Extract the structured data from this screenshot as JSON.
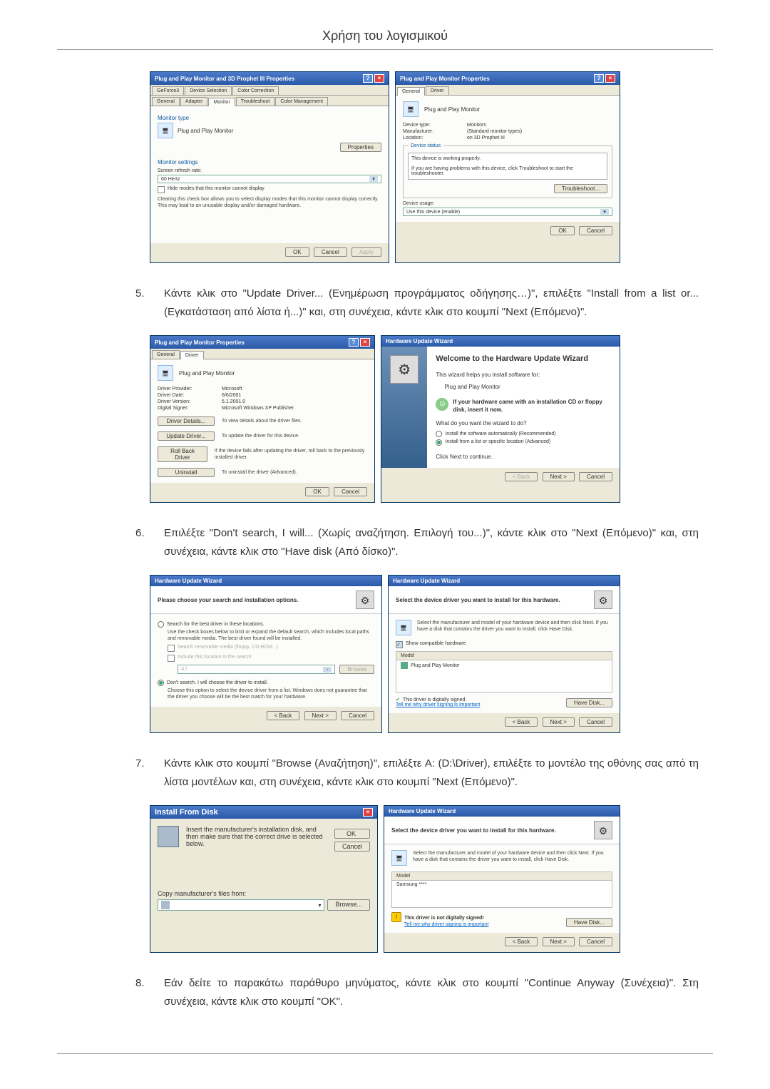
{
  "page_title": "Χρήση του λογισμικού",
  "steps": {
    "s5": {
      "num": "5.",
      "text": "Κάντε κλικ στο \"Update Driver... (Ενημέρωση προγράμματος οδήγησης…)\", επιλέξτε \"Install from a list or...(Εγκατάσταση από λίστα ή...)\" και, στη συνέχεια, κάντε κλικ στο κουμπί \"Next (Επόμενο)\"."
    },
    "s6": {
      "num": "6.",
      "text": "Επιλέξτε \"Don't search, I will... (Χωρίς αναζήτηση. Επιλογή του...)\", κάντε κλικ στο \"Next (Επόμενο)\" και, στη συνέχεια, κάντε κλικ στο \"Have disk (Από δίσκο)\"."
    },
    "s7": {
      "num": "7.",
      "text": "Κάντε κλικ στο κουμπί \"Browse (Αναζήτηση)\", επιλέξτε A: (D:\\Driver), επιλέξτε το μοντέλο της οθόνης σας από τη λίστα μοντέλων και, στη συνέχεια, κάντε κλικ στο κουμπί \"Next (Επόμενο)\"."
    },
    "s8": {
      "num": "8.",
      "text": "Εάν δείτε το παρακάτω παράθυρο μηνύματος, κάντε κλικ στο κουμπί \"Continue Anyway (Συνέχεια)\". Στη συνέχεια, κάντε κλικ στο κουμπί \"OK\"."
    }
  },
  "dlg1": {
    "title": "Plug and Play Monitor and 3D Prophet III Properties",
    "tabs_row1": [
      "GeForce3",
      "Device Selection",
      "Color Correction"
    ],
    "tabs_row2": [
      "General",
      "Adapter",
      "Monitor",
      "Troubleshoot",
      "Color Management"
    ],
    "monitor_type": "Monitor type",
    "monitor_name": "Plug and Play Monitor",
    "properties_btn": "Properties",
    "monitor_settings": "Monitor settings",
    "refresh_label": "Screen refresh rate:",
    "refresh_value": "60 Hertz",
    "hide_modes": "Hide modes that this monitor cannot display",
    "hide_note": "Clearing this check box allows you to select display modes that this monitor cannot display correctly. This may lead to an unusable display and/or damaged hardware.",
    "ok": "OK",
    "cancel": "Cancel",
    "apply": "Apply"
  },
  "dlg2": {
    "title": "Plug and Play Monitor Properties",
    "tabs": [
      "General",
      "Driver"
    ],
    "name": "Plug and Play Monitor",
    "dev_type_l": "Device type:",
    "dev_type_v": "Monitors",
    "mfr_l": "Manufacturer:",
    "mfr_v": "(Standard monitor types)",
    "loc_l": "Location:",
    "loc_v": "on 3D Prophet III",
    "status_legend": "Device status",
    "status_text": "This device is working properly.",
    "status_text2": "If you are having problems with this device, click Troubleshoot to start the troubleshooter.",
    "troubleshoot": "Troubleshoot...",
    "usage_l": "Device usage:",
    "usage_v": "Use this device (enable)",
    "ok": "OK",
    "cancel": "Cancel"
  },
  "dlg3": {
    "title": "Plug and Play Monitor Properties",
    "tabs": [
      "General",
      "Driver"
    ],
    "name": "Plug and Play Monitor",
    "provider_l": "Driver Provider:",
    "provider_v": "Microsoft",
    "date_l": "Driver Date:",
    "date_v": "6/6/2001",
    "ver_l": "Driver Version:",
    "ver_v": "5.1.2001.0",
    "signer_l": "Digital Signer:",
    "signer_v": "Microsoft Windows XP Publisher",
    "details_btn": "Driver Details...",
    "details_txt": "To view details about the driver files.",
    "update_btn": "Update Driver...",
    "update_txt": "To update the driver for this device.",
    "rollback_btn": "Roll Back Driver",
    "rollback_txt": "If the device fails after updating the driver, roll back to the previously installed driver.",
    "uninstall_btn": "Uninstall",
    "uninstall_txt": "To uninstall the driver (Advanced).",
    "ok": "OK",
    "cancel": "Cancel"
  },
  "dlg4": {
    "title": "Hardware Update Wizard",
    "welcome": "Welcome to the Hardware Update Wizard",
    "intro": "This wizard helps you install software for:",
    "device": "Plug and Play Monitor",
    "cd_note": "If your hardware came with an installation CD or floppy disk, insert it now.",
    "q": "What do you want the wizard to do?",
    "opt1": "Install the software automatically (Recommended)",
    "opt2": "Install from a list or specific location (Advanced)",
    "cont": "Click Next to continue.",
    "back": "< Back",
    "next": "Next >",
    "cancel": "Cancel"
  },
  "dlg5": {
    "title": "Hardware Update Wizard",
    "header": "Please choose your search and installation options.",
    "r1": "Search for the best driver in these locations.",
    "r1_note": "Use the check boxes below to limit or expand the default search, which includes local paths and removable media. The best driver found will be installed.",
    "c1": "Search removable media (floppy, CD-ROM...)",
    "c2": "Include this location in the search:",
    "path": "A:\\",
    "browse": "Browse",
    "r2": "Don't search. I will choose the driver to install.",
    "r2_note": "Choose this option to select the device driver from a list. Windows does not guarantee that the driver you choose will be the best match for your hardware.",
    "back": "< Back",
    "next": "Next >",
    "cancel": "Cancel"
  },
  "dlg6": {
    "title": "Hardware Update Wizard",
    "header": "Select the device driver you want to install for this hardware.",
    "sub": "Select the manufacturer and model of your hardware device and then click Next. If you have a disk that contains the driver you want to install, click Have Disk.",
    "show_compat": "Show compatible hardware",
    "model_hdr": "Model",
    "model_item": "Plug and Play Monitor",
    "signed": "This driver is digitally signed.",
    "tell": "Tell me why driver signing is important",
    "have_disk": "Have Disk...",
    "back": "< Back",
    "next": "Next >",
    "cancel": "Cancel"
  },
  "dlg7": {
    "title": "Install From Disk",
    "text": "Insert the manufacturer's installation disk, and then make sure that the correct drive is selected below.",
    "ok": "OK",
    "cancel": "Cancel",
    "copy_l": "Copy manufacturer's files from:",
    "browse": "Browse..."
  },
  "dlg8": {
    "title": "Hardware Update Wizard",
    "header": "Select the device driver you want to install for this hardware.",
    "sub": "Select the manufacturer and model of your hardware device and then click Next. If you have a disk that contains the driver you want to install, click Have Disk.",
    "model_hdr": "Model",
    "model_item": "Samsung ****",
    "not_signed": "This driver is not digitally signed!",
    "tell": "Tell me why driver signing is important",
    "have_disk": "Have Disk...",
    "back": "< Back",
    "next": "Next >",
    "cancel": "Cancel"
  }
}
